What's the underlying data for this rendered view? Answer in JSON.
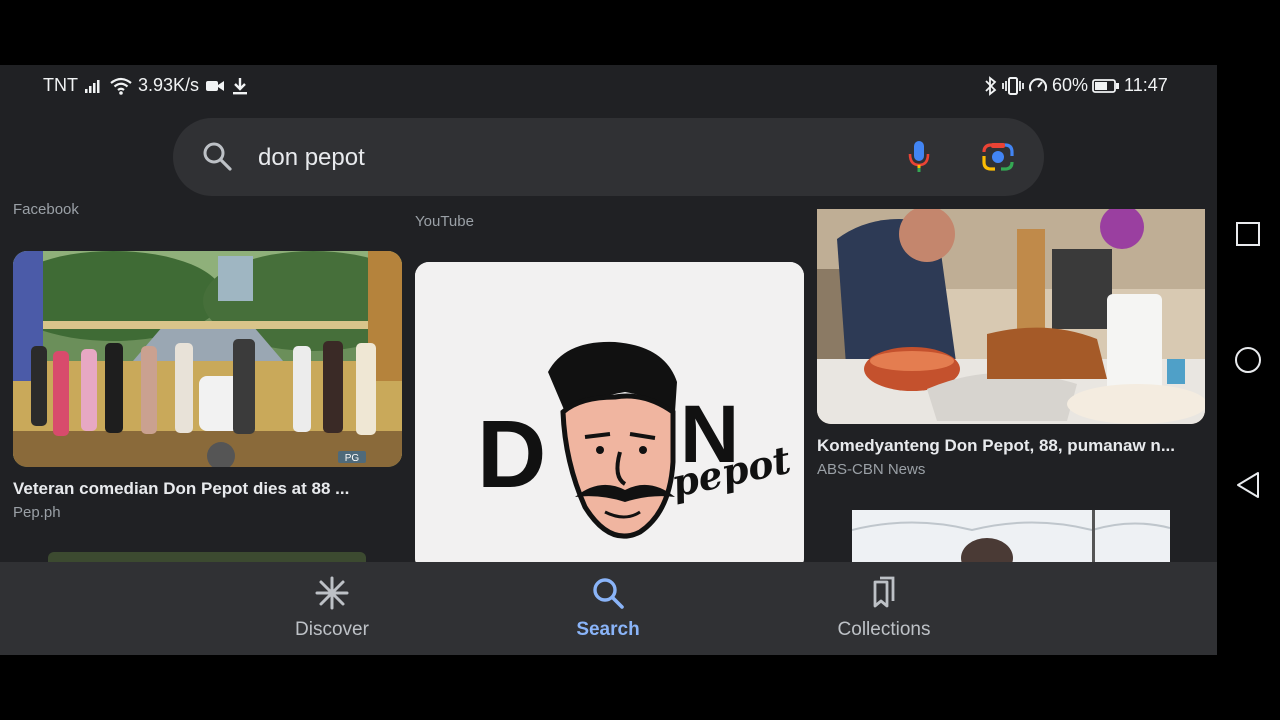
{
  "status_bar": {
    "carrier": "TNT",
    "net_speed": "3.93K/s",
    "battery": "60%",
    "time": "11:47"
  },
  "search": {
    "query": "don pepot",
    "search_icon": "search-icon",
    "mic_icon": "mic-icon",
    "lens_icon": "google-lens-icon"
  },
  "results": {
    "col1_top_source": "Facebook",
    "col2_top_source": "YouTube",
    "card1": {
      "title": "Veteran comedian Don Pepot dies at 88 ...",
      "source": "Pep.ph"
    },
    "card2": {
      "logo_text_top": "DON",
      "logo_text_bottom": "pepot"
    },
    "card3": {
      "title": "Komedyanteng Don Pepot, 88, pumanaw n...",
      "source": "ABS-CBN News"
    }
  },
  "bottom_nav": {
    "tabs": [
      {
        "label": "Discover",
        "icon": "asterisk-icon",
        "active": false
      },
      {
        "label": "Search",
        "icon": "search-icon",
        "active": true
      },
      {
        "label": "Collections",
        "icon": "bookmarks-icon",
        "active": false
      }
    ],
    "active_color": "#8ab4f8",
    "inactive_color": "#bdc1c6"
  },
  "system_nav": [
    "recents-icon",
    "home-icon",
    "back-icon"
  ]
}
